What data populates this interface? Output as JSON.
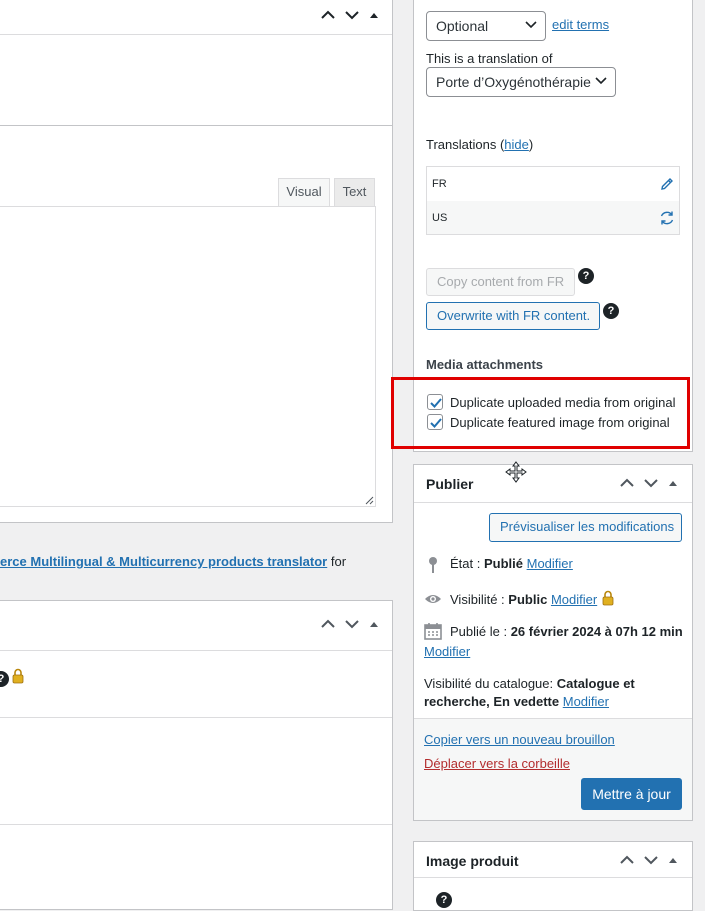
{
  "left": {
    "visual_tab": "Visual",
    "text_tab": "Text",
    "link_text": "erce Multilingual & Multicurrency products translator",
    "link_suffix": " for"
  },
  "wpml": {
    "translation_mode": "Optional",
    "edit_terms": "edit terms",
    "translation_of_label": "This is a translation of",
    "translation_of_value": "Porte d’Oxygénothérapie",
    "translations_label": "Translations (",
    "translations_hide": "hide",
    "translations_close": ")",
    "languages": [
      {
        "code": "FR"
      },
      {
        "code": "US"
      }
    ],
    "copy_button": "Copy content from FR",
    "overwrite_button": "Overwrite with FR content.",
    "media_title": "Media attachments",
    "media_options": [
      {
        "label": "Duplicate uploaded media from original",
        "checked": true
      },
      {
        "label": "Duplicate featured image from original",
        "checked": true
      }
    ],
    "highlight_color": "#e00000"
  },
  "publish": {
    "title": "Publier",
    "preview_button": "Prévisualiser les modifications",
    "status_label": "État : ",
    "status_value": "Publié",
    "status_edit": "Modifier",
    "visibility_label": "Visibilité : ",
    "visibility_value": "Public",
    "visibility_edit": "Modifier",
    "published_label": "Publié le : ",
    "published_value": "26 février 2024 à 07h 12 min",
    "published_edit": "Modifier",
    "catalog_label": "Visibilité du catalogue: ",
    "catalog_value_1": "Catalogue et",
    "catalog_value_2": "recherche, En vedette",
    "catalog_edit": "Modifier",
    "copy_draft": "Copier vers un nouveau brouillon",
    "trash": "Déplacer vers la corbeille",
    "update_button": "Mettre à jour"
  },
  "product_image": {
    "title": "Image produit"
  },
  "colors": {
    "accent": "#2271b1",
    "danger": "#b32d2e",
    "border": "#c3c4c7"
  }
}
